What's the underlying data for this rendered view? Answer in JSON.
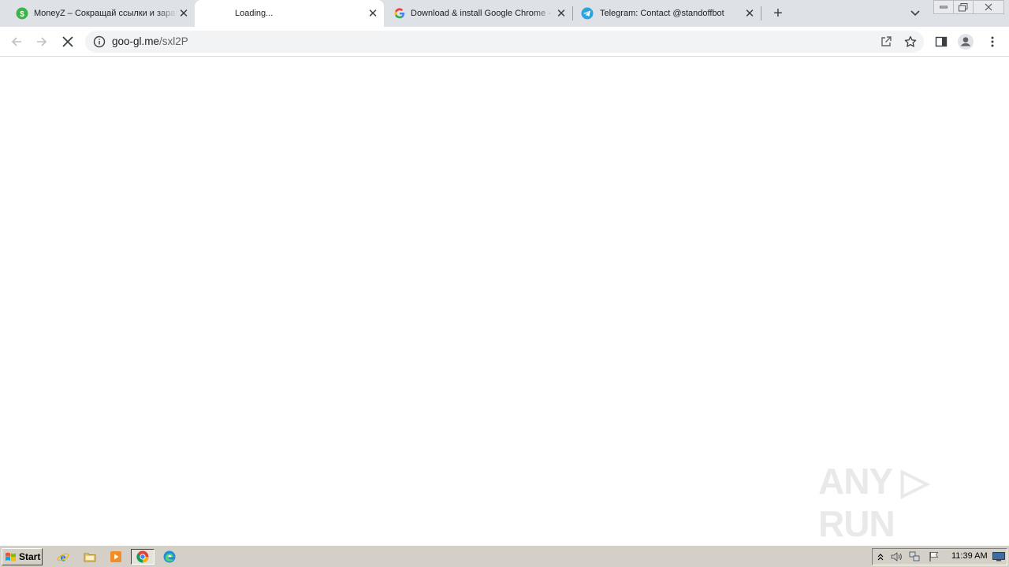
{
  "browser": {
    "tabs": [
      {
        "title": "MoneyZ – Сокращай ссылки и зараб",
        "icon": "moneyz-icon",
        "active": false
      },
      {
        "title": "Loading...",
        "icon": "none",
        "active": true
      },
      {
        "title": "Download & install Google Chrome - G",
        "icon": "google-icon",
        "active": false
      },
      {
        "title": "Telegram: Contact @standoffbot",
        "icon": "telegram-icon",
        "active": false
      }
    ],
    "close_glyph": "✕",
    "new_tab_glyph": "+",
    "url_host": "goo-gl.me",
    "url_path": "/sxl2P"
  },
  "watermark": {
    "text": "ANY ▷ RUN"
  },
  "taskbar": {
    "start_label": "Start",
    "clock": "11:39 AM",
    "quick_launch": [
      "ie-icon",
      "folder-icon",
      "media-player-icon",
      "chrome-icon",
      "edge-icon"
    ]
  },
  "colors": {
    "tabstrip": "#dee1e6",
    "active_tab": "#ffffff",
    "omnibox": "#f1f3f4",
    "taskbar": "#d4d0c8"
  }
}
